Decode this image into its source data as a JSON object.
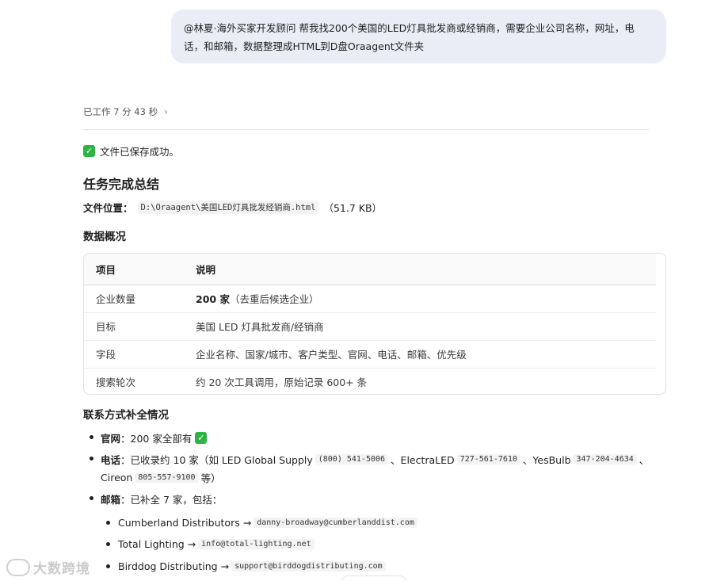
{
  "user_message": {
    "line1": "@林夏·海外买家开发顾问 帮我找200个美国的LED灯具批发商或经销商，需要企业公司名称，网址，电",
    "line2": "话，和邮箱，数据整理成HTML到D盘Oraagent文件夹"
  },
  "worked": {
    "label": "已工作 7 分 43 秒"
  },
  "saved": {
    "icon": "check-mark-icon",
    "text": "文件已保存成功。"
  },
  "summary": {
    "title": "任务完成总结",
    "file_label": "文件位置：",
    "file_path": "D:\\Oraagent\\美国LED灯具批发经销商.html",
    "file_size": "（51.7 KB）"
  },
  "overview": {
    "title": "数据概况",
    "headers": [
      "项目",
      "说明"
    ],
    "rows": [
      {
        "item": "企业数量",
        "desc_bold": "200 家",
        "desc": "（去重后候选企业）"
      },
      {
        "item": "目标",
        "desc_bold": "",
        "desc": "美国 LED 灯具批发商/经销商"
      },
      {
        "item": "字段",
        "desc_bold": "",
        "desc": "企业名称、国家/城市、客户类型、官网、电话、邮箱、优先级"
      },
      {
        "item": "搜索轮次",
        "desc_bold": "",
        "desc": "约 20 次工具调用，原始记录 600+ 条"
      }
    ]
  },
  "contacts": {
    "title": "联系方式补全情况",
    "website": {
      "label": "官网",
      "text": "：200 家全部有"
    },
    "phone": {
      "label": "电话",
      "prefix": "：已收录约 10 家（如 LED Global Supply",
      "p1": "(800) 541-5006",
      "sep1": "、ElectraLED",
      "p2": "727-561-7610",
      "sep2": "、YesBulb",
      "p3": "347-204-4634",
      "sep3": "、",
      "line2_pre": "Cireon",
      "p4": "805-557-9100",
      "line2_post": "等）"
    },
    "email": {
      "label": "邮箱",
      "text": "：已补全 7 家，包括：",
      "items": [
        {
          "name": "Cumberland Distributors →",
          "email": "danny-broadway@cumberlanddist.com"
        },
        {
          "name": "Total Lighting →",
          "email": "info@total-lighting.net"
        },
        {
          "name": "Birddog Distributing →",
          "email": "support@birddogdistributing.com"
        }
      ]
    }
  },
  "watermark": {
    "text": "大数跨境"
  }
}
